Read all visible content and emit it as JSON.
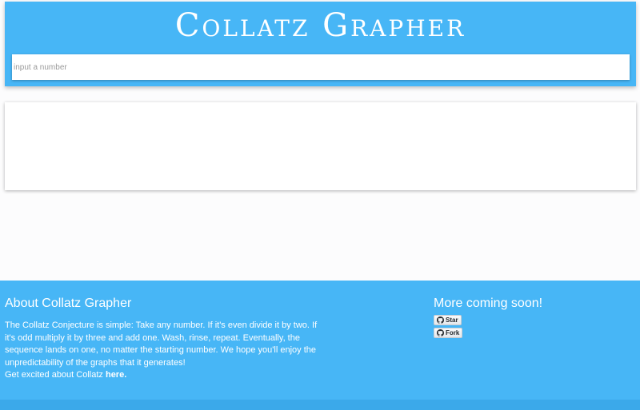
{
  "header": {
    "title": "Collatz Grapher",
    "input_placeholder": "input a number"
  },
  "footer": {
    "about": {
      "heading": "About Collatz Grapher",
      "body": "The Collatz Conjecture is simple: Take any number. If it's even divide it by two. If it's odd multiply it by three and add one. Wash, rinse, repeat. Eventually, the sequence lands on one, no matter the starting number. We hope you'll enjoy the unpredictability of the graphs that it generates!",
      "excited_prefix": "Get excited about Collatz ",
      "excited_link": "here."
    },
    "more": {
      "heading": "More coming soon!",
      "star_label": "Star",
      "fork_label": "Fork",
      "icon": "github-icon"
    }
  },
  "colors": {
    "primary": "#47b6f6",
    "footer_bar": "#3ba9ea",
    "background": "#fcfcfd"
  }
}
